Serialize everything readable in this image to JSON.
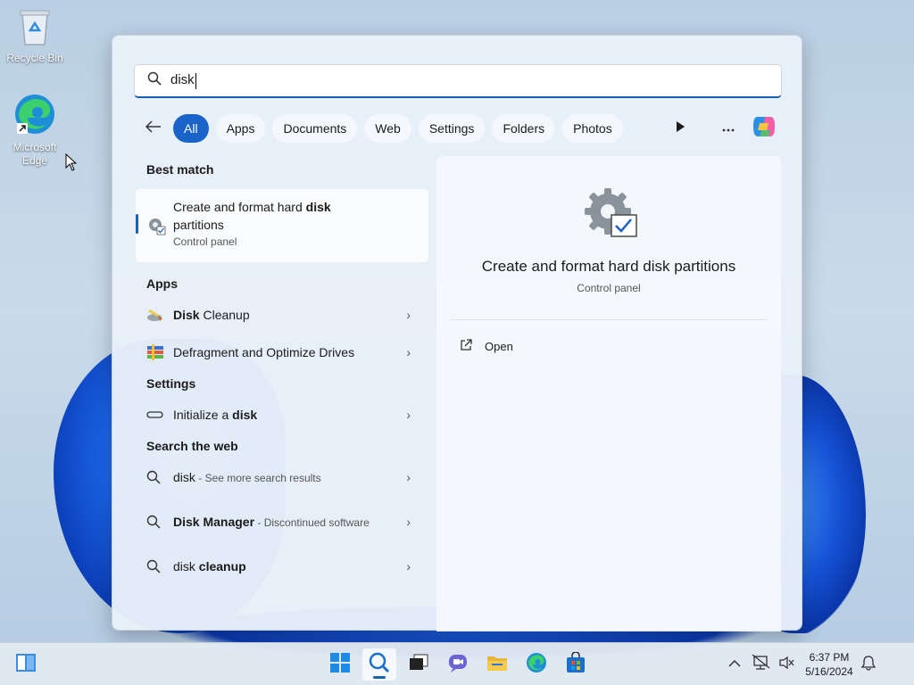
{
  "desktop": {
    "icons": [
      {
        "label": "Recycle Bin"
      },
      {
        "label": "Microsoft Edge"
      }
    ]
  },
  "search": {
    "query": "disk",
    "filters": [
      "All",
      "Apps",
      "Documents",
      "Web",
      "Settings",
      "Folders",
      "Photos"
    ],
    "active_filter": "All"
  },
  "results": {
    "best_match_header": "Best match",
    "best_match": {
      "title_prefix": "Create and format hard ",
      "title_bold": "disk",
      "title_suffix": " partitions",
      "subtitle": "Control panel"
    },
    "apps_header": "Apps",
    "apps": [
      {
        "bold": "Disk",
        "rest": " Cleanup"
      },
      {
        "bold": "",
        "rest": "Defragment and Optimize Drives"
      }
    ],
    "settings_header": "Settings",
    "settings": [
      {
        "prefix": "Initialize a ",
        "bold": "disk"
      }
    ],
    "web_header": "Search the web",
    "web": [
      {
        "query": "disk",
        "hint": " - See more search results"
      },
      {
        "bold": "Disk Manager",
        "hint": " - Discontinued software"
      },
      {
        "prefix": "disk ",
        "bold": "cleanup"
      }
    ]
  },
  "preview": {
    "title": "Create and format hard disk partitions",
    "subtitle": "Control panel",
    "action_open": "Open"
  },
  "taskbar": {
    "time": "6:37 PM",
    "date": "5/16/2024"
  },
  "colors": {
    "accent": "#1a63c8"
  }
}
